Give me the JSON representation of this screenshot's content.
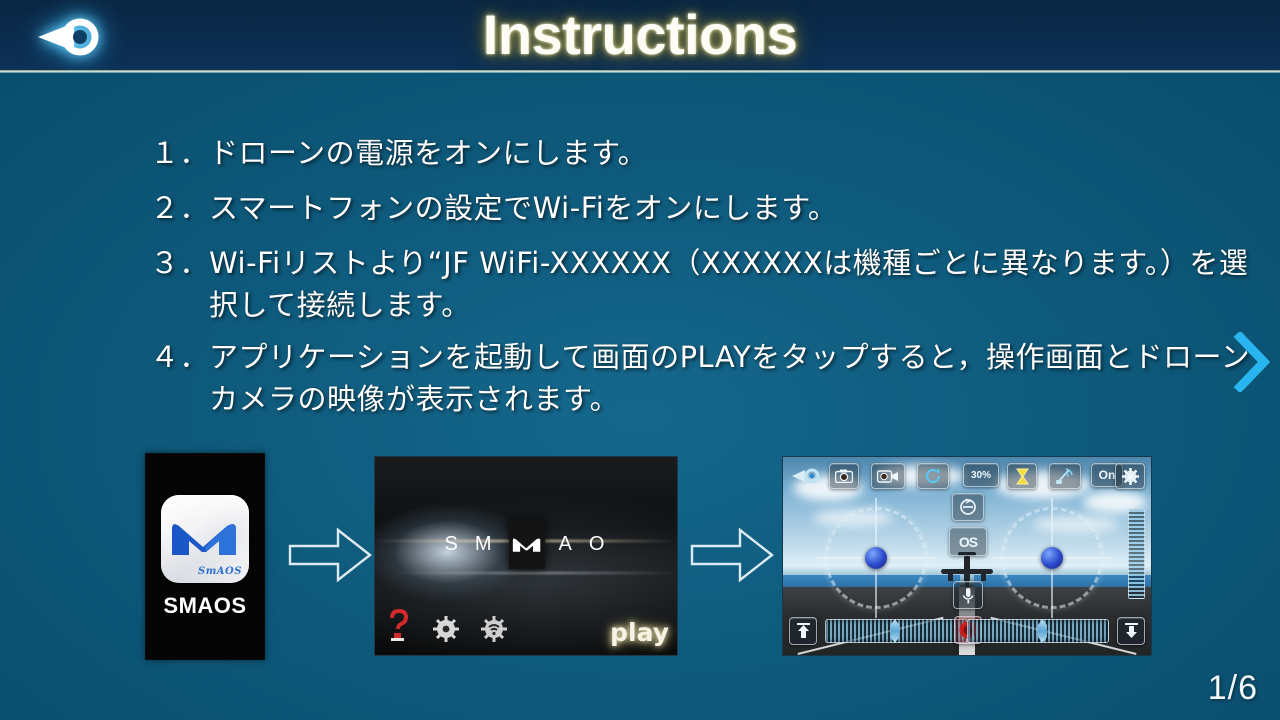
{
  "header": {
    "title": "Instructions",
    "back_icon": "back-arrow-icon"
  },
  "steps": [
    {
      "number": "１．",
      "text": "ドローンの電源をオンにします。"
    },
    {
      "number": "２．",
      "text": "スマートフォンの設定でWi-Fiをオンにします。"
    },
    {
      "number": "３．",
      "text": "Wi-Fiリストより“JF WiFi-XXXXXX（XXXXXXは機種ごとに異なります。）を選択して接続します。"
    },
    {
      "number": "４．",
      "text": "アプリケーションを起動して画面のPLAYをタップすると，操作画面とドローンカメラの映像が表示されます。"
    }
  ],
  "navigation": {
    "next_chevron": "chevron-right-icon",
    "page_indicator": "1/6"
  },
  "flow": {
    "app_thumb": {
      "label": "SMAOS",
      "icon_brand_text": "SmAOS",
      "logo": "smaos-m-logo"
    },
    "arrow_1": "right-arrow-icon",
    "arrow_2": "right-arrow-icon",
    "splash_thumb": {
      "letters": [
        "S",
        "M",
        "A",
        "O"
      ],
      "logo": "smaos-m-logo",
      "play_label": "play",
      "bottom_icons": [
        "help-question-icon",
        "gear-icon",
        "wifi-gear-icon"
      ]
    },
    "control_thumb": {
      "top_icons": [
        {
          "name": "back-arrow-icon",
          "label": ""
        },
        {
          "name": "camera-icon",
          "label": ""
        },
        {
          "name": "video-camera-icon",
          "label": ""
        },
        {
          "name": "rotate-icon",
          "label": ""
        },
        {
          "name": "battery-percent-badge",
          "label": "30%"
        },
        {
          "name": "hourglass-icon",
          "label": ""
        },
        {
          "name": "signal-icon",
          "label": ""
        },
        {
          "name": "on-toggle-badge",
          "label": "On"
        },
        {
          "name": "settings-gear-icon",
          "label": ""
        }
      ],
      "center_icons": [
        {
          "name": "flip-mode-icon",
          "label": ""
        },
        {
          "name": "os-mode-badge",
          "label": "OS"
        }
      ],
      "bottom_icons": [
        {
          "name": "takeoff-up-icon",
          "label": ""
        },
        {
          "name": "microphone-icon",
          "label": ""
        },
        {
          "name": "record-stop-button",
          "label": ""
        },
        {
          "name": "land-down-icon",
          "label": ""
        }
      ]
    }
  },
  "colors": {
    "background_teal": "#0e5a7c",
    "header_navy": "#0b2c4e",
    "title_glow": "#a8a257",
    "chevron_blue": "#29b6f0",
    "accent_white": "#ffffff"
  }
}
